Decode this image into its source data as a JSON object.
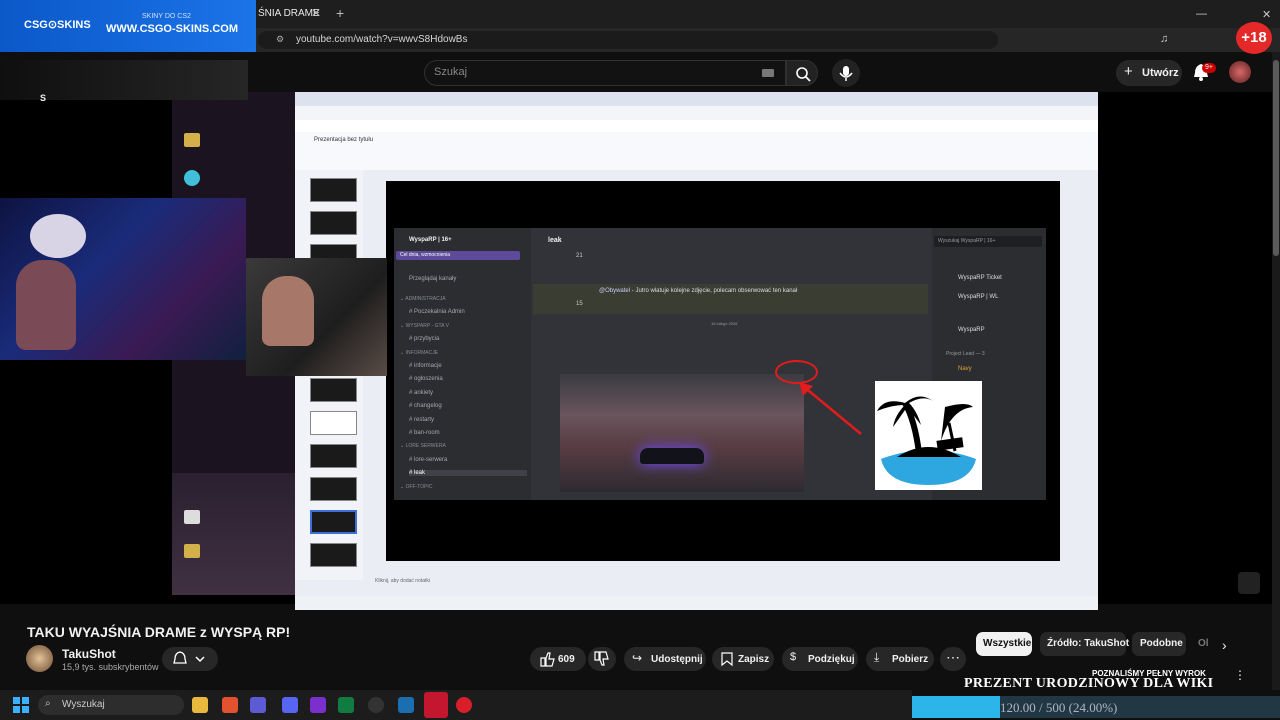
{
  "browser": {
    "tab_title": "ŚNIA DRAME",
    "url": "youtube.com/watch?v=wwvS8HdowBs"
  },
  "banner": {
    "logo": "CSG⊙SKINS",
    "tagline": "SKINY DO CS2",
    "url": "WWW.CSGO-SKINS.COM"
  },
  "overlay_badge": "+18",
  "youtube": {
    "search_placeholder": "Szukaj",
    "create_label": "Utwórz",
    "notifications": "9+"
  },
  "inner_screen": {
    "slides_title": "Prezentacja bez tytułu",
    "notes_placeholder": "Kliknij, aby dodać notatki",
    "discord": {
      "server": "WyspaRP | 16+",
      "boost": "Cel dnia, wzmocnienia",
      "channel": "leak",
      "message_mention": "@Obywatel",
      "message": " - Jutro wlatuje kolejne zdjęcie, polecam obserwować ten kanał",
      "reaction_1": "21",
      "reaction_2": "15",
      "date": "16 lutego 2026",
      "search_placeholder": "Wyszukaj WyspaRP | 16+",
      "channels": [
        {
          "type": "cat",
          "label": "ADMINISTRACJA"
        },
        {
          "type": "ch",
          "label": "Poczekalnia Admin"
        },
        {
          "type": "cat",
          "label": "WYSPARP - GTA V"
        },
        {
          "type": "ch",
          "label": "przybycia"
        },
        {
          "type": "cat",
          "label": "INFORMACJE"
        },
        {
          "type": "ch",
          "label": "informacje"
        },
        {
          "type": "ch",
          "label": "ogłoszenia"
        },
        {
          "type": "ch",
          "label": "ankiety"
        },
        {
          "type": "ch",
          "label": "changelog"
        },
        {
          "type": "ch",
          "label": "restarty"
        },
        {
          "type": "ch",
          "label": "ban-room"
        },
        {
          "type": "cat",
          "label": "LORE SERWERA"
        },
        {
          "type": "ch",
          "label": "lore-serwera"
        },
        {
          "type": "ch",
          "label": "leak"
        },
        {
          "type": "cat",
          "label": "OFF-TOPIC"
        }
      ],
      "members": [
        "WyspaRP Ticket",
        "WyspaRP | WL",
        "WyspaRP",
        "Navy"
      ],
      "members_header": "Project Lead — 3",
      "browse_channels": "Przeglądaj kanały"
    }
  },
  "video": {
    "title": "TAKU WYAJŚNIA DRAME z WYSPĄ RP!",
    "channel": "TakuShot",
    "subscribers": "15,9 tys. subskrybentów",
    "likes": "609",
    "share": "Udostępnij",
    "save": "Zapisz",
    "thanks": "Podziękuj",
    "download": "Pobierz"
  },
  "chips": [
    "Wszystkie",
    "Źródło: TakuShot",
    "Podobne",
    "Ol"
  ],
  "promo": {
    "line": "POZNALIŚMY PEŁNY WYROK",
    "text": "PREZENT URODZINOWY DLA WIKI",
    "goal": "120.00 / 500 (24.00%)",
    "goal_progress": 0.24
  },
  "taskbar": {
    "search": "Wyszukaj"
  },
  "colors": {
    "accent": "#cc0000",
    "banner": "#1b74e8",
    "goal_fill": "#2bb5e8"
  }
}
